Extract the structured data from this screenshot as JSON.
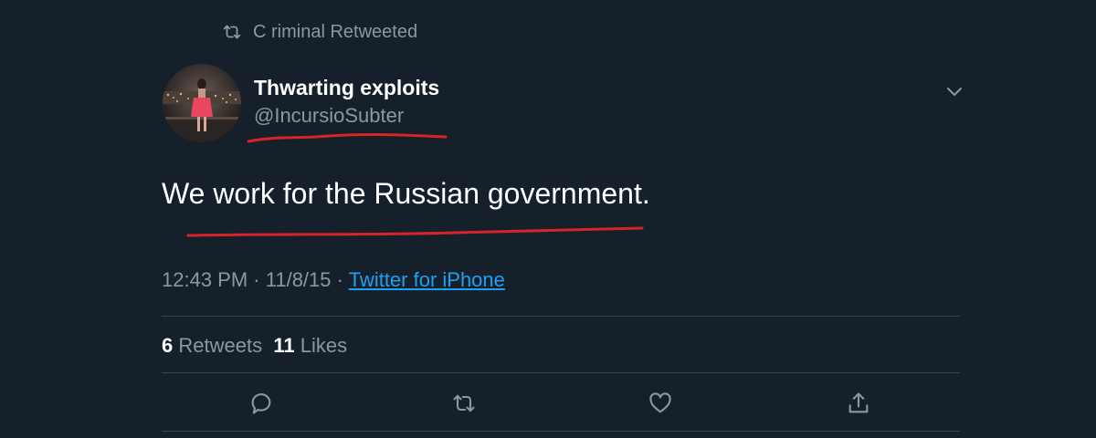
{
  "retweet_context": {
    "icon": "retweet-icon",
    "text": "C riminal Retweeted"
  },
  "tweet": {
    "display_name": "Thwarting exploits",
    "handle": "@IncursioSubter",
    "text": "We work for the Russian government.",
    "time": "12:43 PM",
    "date": "11/8/15",
    "separator": "·",
    "source": "Twitter for iPhone"
  },
  "stats": {
    "retweets_count": "6",
    "retweets_label": "Retweets",
    "likes_count": "11",
    "likes_label": "Likes"
  },
  "actions": [
    {
      "icon": "reply-icon"
    },
    {
      "icon": "retweet-icon"
    },
    {
      "icon": "like-icon"
    },
    {
      "icon": "share-icon"
    }
  ],
  "colors": {
    "background": "#15202b",
    "text_primary": "#ffffff",
    "text_secondary": "#8899a6",
    "link": "#1da1f2",
    "divider": "#38444d",
    "annotation": "#d9232b"
  }
}
